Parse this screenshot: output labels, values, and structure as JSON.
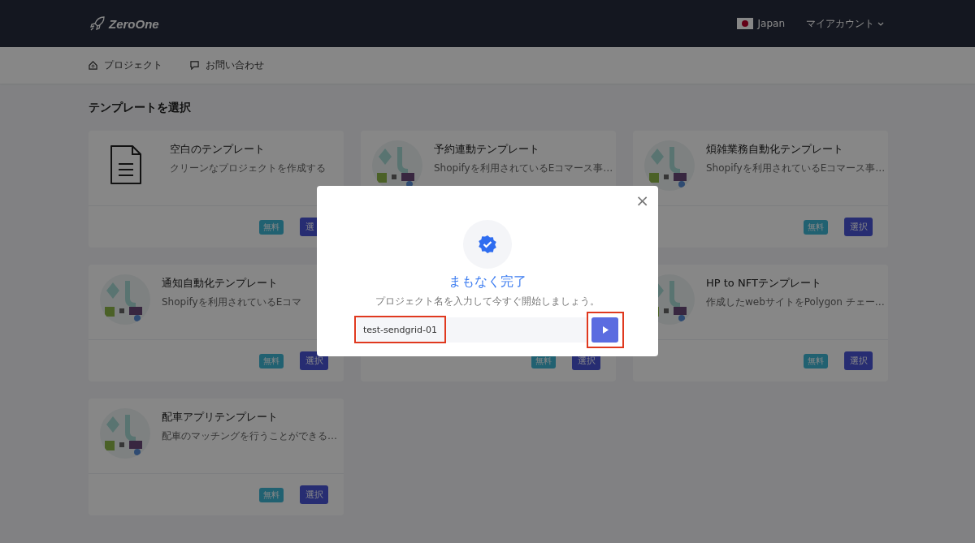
{
  "header": {
    "logo": "ZeroOne",
    "country": "Japan",
    "account": "マイアカウント"
  },
  "nav": [
    {
      "label": "プロジェクト",
      "kind": "home"
    },
    {
      "label": "お問い合わせ",
      "kind": "chat"
    }
  ],
  "heading": "テンプレートを選択",
  "templates": [
    {
      "kind": "document",
      "title": "空白のテンプレート",
      "description": "クリーンなプロジェクトを作成する",
      "badge": "無料",
      "button": "選"
    },
    {
      "kind": "picture",
      "title": "予約連動テンプレート",
      "description": "Shopifyを利用されているEコマース事…"
    },
    {
      "kind": "picture",
      "title": "煩雑業務自動化テンプレート",
      "description": "Shopifyを利用されているEコマース事…",
      "badge": "無料",
      "button": "選択"
    },
    {
      "kind": "picture",
      "title": "通知自動化テンプレート",
      "description": "Shopifyを利用されているEコマ",
      "badge": "無料",
      "button": "選択"
    },
    {
      "badge": "無料",
      "button": "選択"
    },
    {
      "kind": "picture",
      "title": "HP to NFTテンプレート",
      "description": "作成したwebサイトをPolygon チェー…",
      "badge": "無料",
      "button": "選択"
    },
    {
      "kind": "picture",
      "title": "配車アプリテンプレート",
      "description": "配車のマッチングを行うことができる…",
      "badge": "無料",
      "button": "選択"
    }
  ],
  "modal": {
    "close": "×",
    "title": "まもなく完了",
    "message": "プロジェクト名を入力して今すぐ開始しましょう。",
    "input": {
      "value": "test-sendgrid-01",
      "highlighted": true
    },
    "submit": {
      "highlighted": true
    }
  }
}
